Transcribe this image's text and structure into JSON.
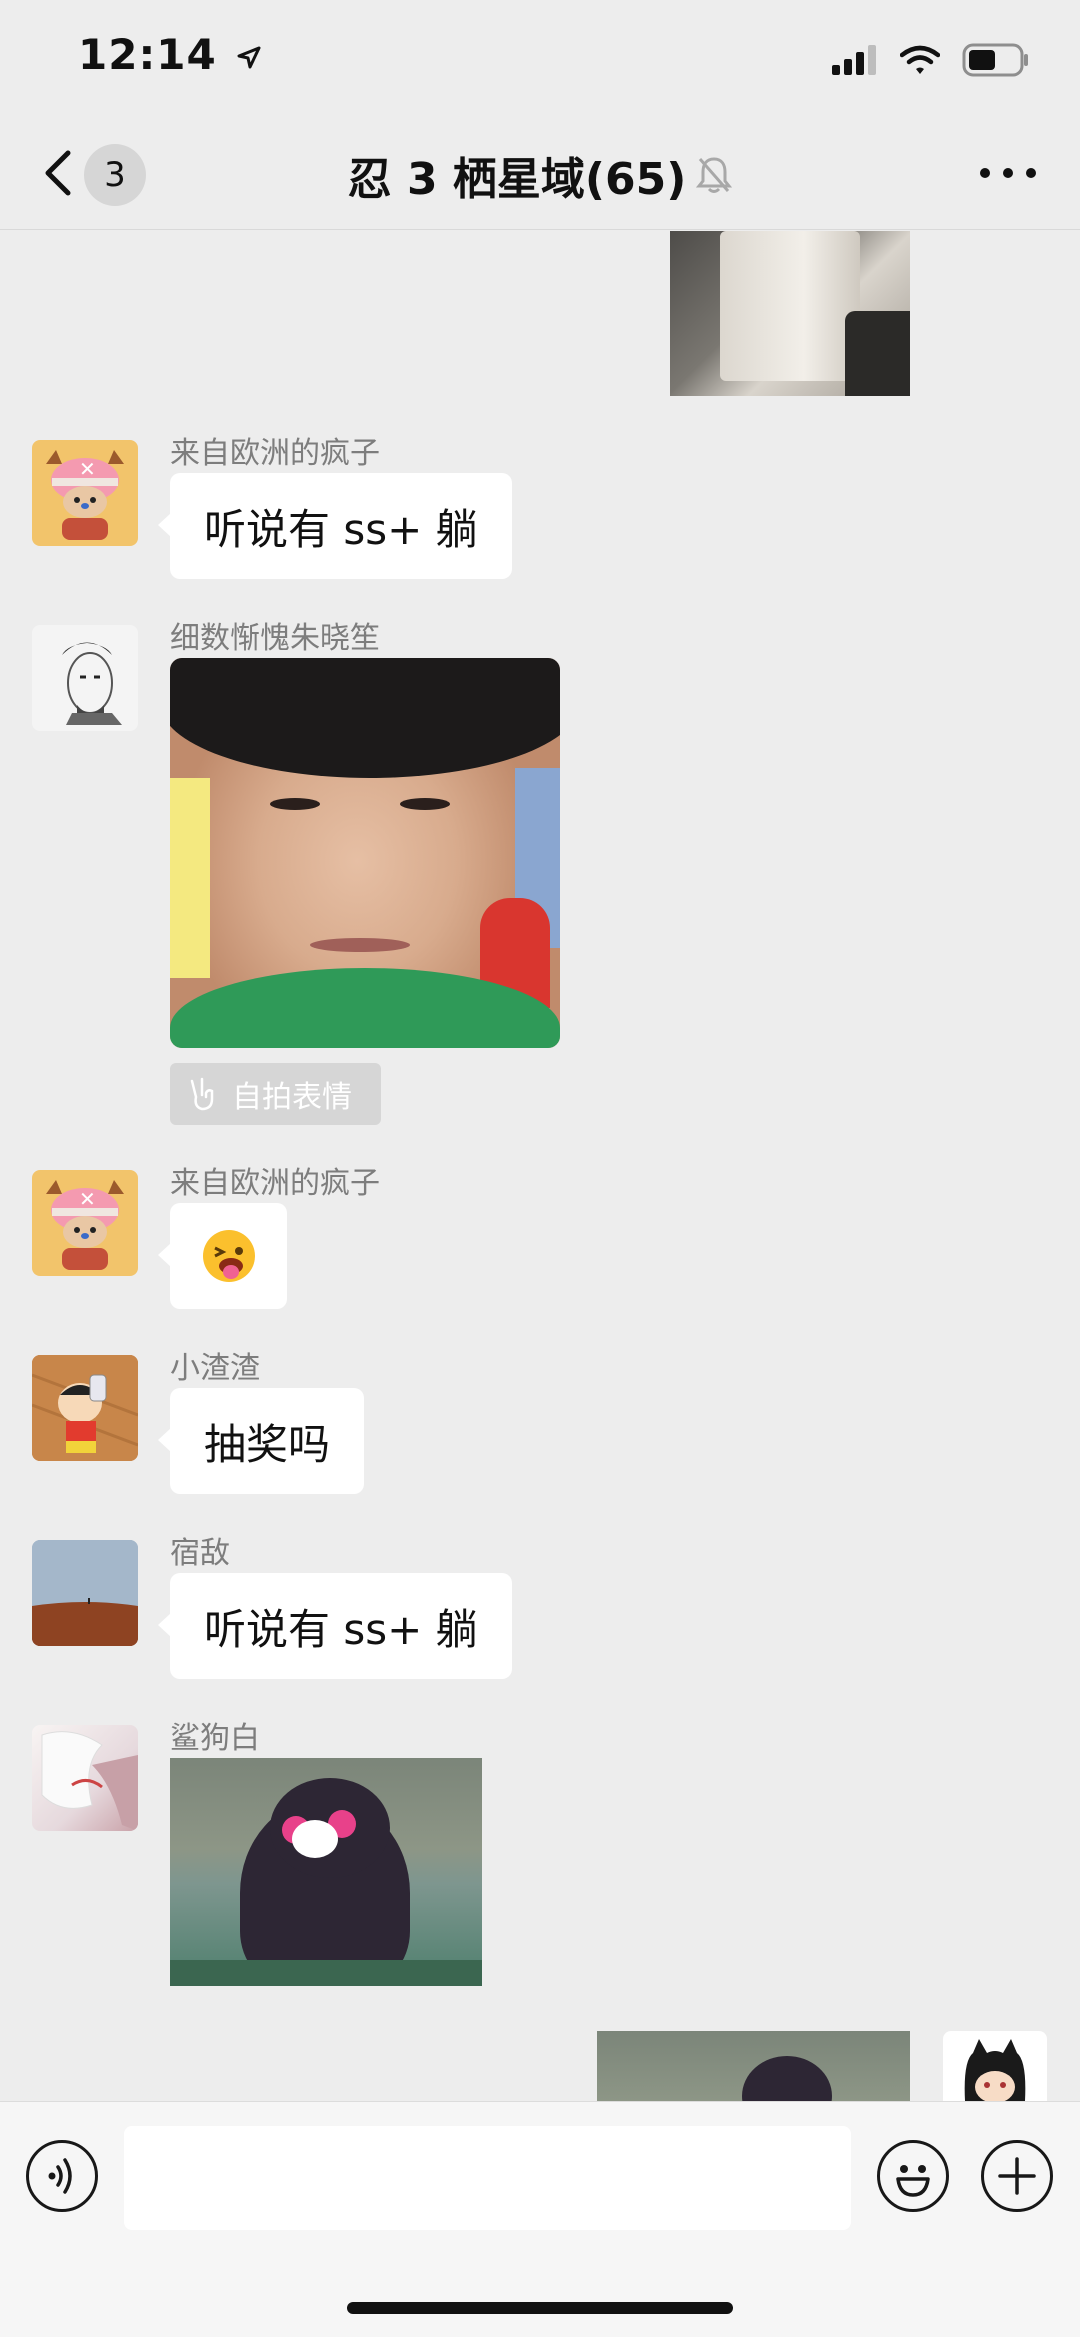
{
  "status_bar": {
    "time": "12:14",
    "icons": [
      "location-arrow-icon",
      "cellular-signal-icon",
      "wifi-icon",
      "battery-icon"
    ]
  },
  "navbar": {
    "unread_count": "3",
    "title": "忍 3 栖星域(65)",
    "icons": [
      "back-chevron-icon",
      "mute-bell-icon",
      "more-dots-icon"
    ]
  },
  "messages": [
    {
      "type": "image",
      "direction": "incoming",
      "description_icon": "photo-bag"
    },
    {
      "sender": "来自欧洲的疯子",
      "type": "text",
      "text": "听说有 ss+ 躺"
    },
    {
      "sender": "细数惭愧朱晓笙",
      "type": "selfie-sticker",
      "tag": "自拍表情"
    },
    {
      "sender": "来自欧洲的疯子",
      "type": "emoji",
      "text": "😝"
    },
    {
      "sender": "小渣渣",
      "type": "text",
      "text": "抽奖吗"
    },
    {
      "sender": "宿敌",
      "type": "text",
      "text": "听说有 ss+ 躺"
    },
    {
      "sender": "鲨狗白",
      "type": "image"
    },
    {
      "type": "image",
      "direction": "outgoing"
    }
  ],
  "input_bar": {
    "placeholder": "",
    "icons": [
      "voice-icon",
      "emoji-icon",
      "plus-icon"
    ]
  }
}
